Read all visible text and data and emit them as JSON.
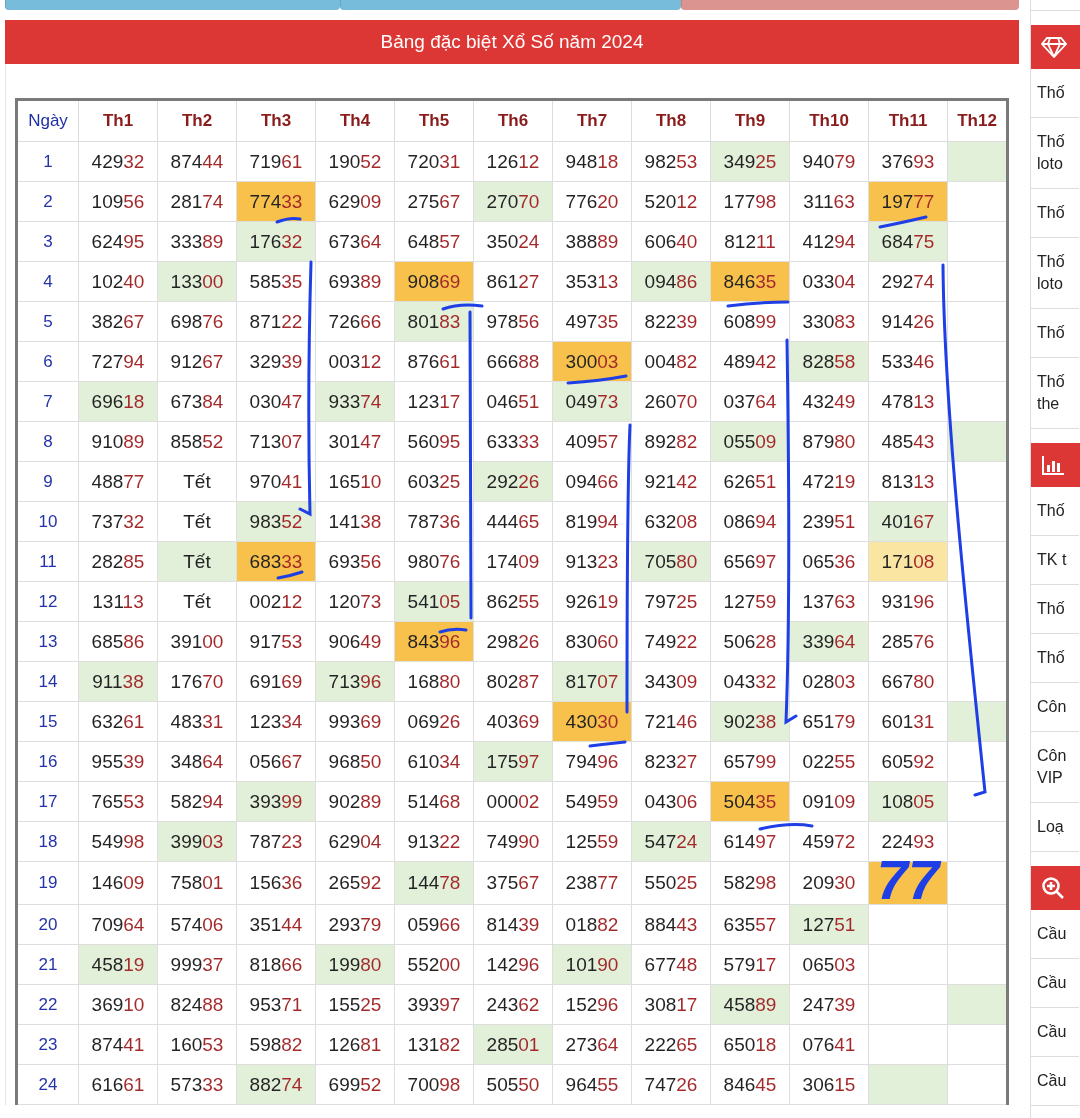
{
  "title_bar": "Bảng đặc biệt Xổ Số năm 2024",
  "table": {
    "columns": [
      "Ngày",
      "Th1",
      "Th2",
      "Th3",
      "Th4",
      "Th5",
      "Th6",
      "Th7",
      "Th8",
      "Th9",
      "Th10",
      "Th11",
      "Th12"
    ],
    "rows": [
      {
        "cells": [
          {
            "kind": "day",
            "value": "1"
          },
          {
            "kind": "number",
            "value": "42932",
            "color": "#ffffff"
          },
          {
            "kind": "number",
            "value": "87444",
            "color": "#ffffff"
          },
          {
            "kind": "number",
            "value": "71961",
            "color": "#ffffff"
          },
          {
            "kind": "number",
            "value": "19052",
            "color": "#ffffff"
          },
          {
            "kind": "number",
            "value": "72031",
            "color": "#ffffff"
          },
          {
            "kind": "number",
            "value": "12612",
            "color": "#ffffff"
          },
          {
            "kind": "number",
            "value": "94818",
            "color": "#ffffff"
          },
          {
            "kind": "number",
            "value": "98253",
            "color": "#ffffff"
          },
          {
            "kind": "number",
            "value": "34925",
            "color": "#e2efd9"
          },
          {
            "kind": "number",
            "value": "94079",
            "color": "#ffffff"
          },
          {
            "kind": "number",
            "value": "37693",
            "color": "#ffffff"
          },
          {
            "kind": "empty",
            "color": "#e2efd9"
          }
        ]
      },
      {
        "cells": [
          {
            "kind": "day",
            "value": "2"
          },
          {
            "kind": "number",
            "value": "10956",
            "color": "#ffffff"
          },
          {
            "kind": "number",
            "value": "28174",
            "color": "#ffffff"
          },
          {
            "kind": "number",
            "value": "77433",
            "color": "#f7c14c"
          },
          {
            "kind": "number",
            "value": "62909",
            "color": "#ffffff"
          },
          {
            "kind": "number",
            "value": "27567",
            "color": "#ffffff"
          },
          {
            "kind": "number",
            "value": "27070",
            "color": "#e2efd9"
          },
          {
            "kind": "number",
            "value": "77620",
            "color": "#ffffff"
          },
          {
            "kind": "number",
            "value": "52012",
            "color": "#ffffff"
          },
          {
            "kind": "number",
            "value": "17798",
            "color": "#ffffff"
          },
          {
            "kind": "number",
            "value": "31163",
            "color": "#ffffff"
          },
          {
            "kind": "number",
            "value": "19777",
            "color": "#f7c14c"
          },
          {
            "kind": "empty",
            "color": "#ffffff"
          }
        ]
      },
      {
        "cells": [
          {
            "kind": "day",
            "value": "3"
          },
          {
            "kind": "number",
            "value": "62495",
            "color": "#ffffff"
          },
          {
            "kind": "number",
            "value": "33389",
            "color": "#ffffff"
          },
          {
            "kind": "number",
            "value": "17632",
            "color": "#e2efd9"
          },
          {
            "kind": "number",
            "value": "67364",
            "color": "#ffffff"
          },
          {
            "kind": "number",
            "value": "64857",
            "color": "#ffffff"
          },
          {
            "kind": "number",
            "value": "35024",
            "color": "#ffffff"
          },
          {
            "kind": "number",
            "value": "38889",
            "color": "#ffffff"
          },
          {
            "kind": "number",
            "value": "60640",
            "color": "#ffffff"
          },
          {
            "kind": "number",
            "value": "81211",
            "color": "#ffffff"
          },
          {
            "kind": "number",
            "value": "41294",
            "color": "#ffffff"
          },
          {
            "kind": "number",
            "value": "68475",
            "color": "#e2efd9"
          },
          {
            "kind": "empty",
            "color": "#ffffff"
          }
        ]
      },
      {
        "cells": [
          {
            "kind": "day",
            "value": "4"
          },
          {
            "kind": "number",
            "value": "10240",
            "color": "#ffffff"
          },
          {
            "kind": "number",
            "value": "13300",
            "color": "#e2efd9"
          },
          {
            "kind": "number",
            "value": "58535",
            "color": "#ffffff"
          },
          {
            "kind": "number",
            "value": "69389",
            "color": "#ffffff"
          },
          {
            "kind": "number",
            "value": "90869",
            "color": "#f7c14c"
          },
          {
            "kind": "number",
            "value": "86127",
            "color": "#ffffff"
          },
          {
            "kind": "number",
            "value": "35313",
            "color": "#ffffff"
          },
          {
            "kind": "number",
            "value": "09486",
            "color": "#e2efd9"
          },
          {
            "kind": "number",
            "value": "84635",
            "color": "#f7c14c"
          },
          {
            "kind": "number",
            "value": "03304",
            "color": "#ffffff"
          },
          {
            "kind": "number",
            "value": "29274",
            "color": "#ffffff"
          },
          {
            "kind": "empty",
            "color": "#ffffff"
          }
        ]
      },
      {
        "cells": [
          {
            "kind": "day",
            "value": "5"
          },
          {
            "kind": "number",
            "value": "38267",
            "color": "#ffffff"
          },
          {
            "kind": "number",
            "value": "69876",
            "color": "#ffffff"
          },
          {
            "kind": "number",
            "value": "87122",
            "color": "#ffffff"
          },
          {
            "kind": "number",
            "value": "72666",
            "color": "#ffffff"
          },
          {
            "kind": "number",
            "value": "80183",
            "color": "#e2efd9"
          },
          {
            "kind": "number",
            "value": "97856",
            "color": "#ffffff"
          },
          {
            "kind": "number",
            "value": "49735",
            "color": "#ffffff"
          },
          {
            "kind": "number",
            "value": "82239",
            "color": "#ffffff"
          },
          {
            "kind": "number",
            "value": "60899",
            "color": "#ffffff"
          },
          {
            "kind": "number",
            "value": "33083",
            "color": "#ffffff"
          },
          {
            "kind": "number",
            "value": "91426",
            "color": "#ffffff"
          },
          {
            "kind": "empty",
            "color": "#ffffff"
          }
        ]
      },
      {
        "cells": [
          {
            "kind": "day",
            "value": "6"
          },
          {
            "kind": "number",
            "value": "72794",
            "color": "#ffffff"
          },
          {
            "kind": "number",
            "value": "91267",
            "color": "#ffffff"
          },
          {
            "kind": "number",
            "value": "32939",
            "color": "#ffffff"
          },
          {
            "kind": "number",
            "value": "00312",
            "color": "#ffffff"
          },
          {
            "kind": "number",
            "value": "87661",
            "color": "#ffffff"
          },
          {
            "kind": "number",
            "value": "66688",
            "color": "#ffffff"
          },
          {
            "kind": "number",
            "value": "30003",
            "color": "#f7c14c"
          },
          {
            "kind": "number",
            "value": "00482",
            "color": "#ffffff"
          },
          {
            "kind": "number",
            "value": "48942",
            "color": "#ffffff"
          },
          {
            "kind": "number",
            "value": "82858",
            "color": "#e2efd9"
          },
          {
            "kind": "number",
            "value": "53346",
            "color": "#ffffff"
          },
          {
            "kind": "empty",
            "color": "#ffffff"
          }
        ]
      },
      {
        "cells": [
          {
            "kind": "day",
            "value": "7"
          },
          {
            "kind": "number",
            "value": "69618",
            "color": "#e2efd9"
          },
          {
            "kind": "number",
            "value": "67384",
            "color": "#ffffff"
          },
          {
            "kind": "number",
            "value": "03047",
            "color": "#ffffff"
          },
          {
            "kind": "number",
            "value": "93374",
            "color": "#e2efd9"
          },
          {
            "kind": "number",
            "value": "12317",
            "color": "#ffffff"
          },
          {
            "kind": "number",
            "value": "04651",
            "color": "#ffffff"
          },
          {
            "kind": "number",
            "value": "04973",
            "color": "#e2efd9"
          },
          {
            "kind": "number",
            "value": "26070",
            "color": "#ffffff"
          },
          {
            "kind": "number",
            "value": "03764",
            "color": "#ffffff"
          },
          {
            "kind": "number",
            "value": "43249",
            "color": "#ffffff"
          },
          {
            "kind": "number",
            "value": "47813",
            "color": "#ffffff"
          },
          {
            "kind": "empty",
            "color": "#ffffff"
          }
        ]
      },
      {
        "cells": [
          {
            "kind": "day",
            "value": "8"
          },
          {
            "kind": "number",
            "value": "91089",
            "color": "#ffffff"
          },
          {
            "kind": "number",
            "value": "85852",
            "color": "#ffffff"
          },
          {
            "kind": "number",
            "value": "71307",
            "color": "#ffffff"
          },
          {
            "kind": "number",
            "value": "30147",
            "color": "#ffffff"
          },
          {
            "kind": "number",
            "value": "56095",
            "color": "#ffffff"
          },
          {
            "kind": "number",
            "value": "63333",
            "color": "#ffffff"
          },
          {
            "kind": "number",
            "value": "40957",
            "color": "#ffffff"
          },
          {
            "kind": "number",
            "value": "89282",
            "color": "#ffffff"
          },
          {
            "kind": "number",
            "value": "05509",
            "color": "#e2efd9"
          },
          {
            "kind": "number",
            "value": "87980",
            "color": "#ffffff"
          },
          {
            "kind": "number",
            "value": "48543",
            "color": "#ffffff"
          },
          {
            "kind": "empty",
            "color": "#e2efd9"
          }
        ]
      },
      {
        "cells": [
          {
            "kind": "day",
            "value": "9"
          },
          {
            "kind": "number",
            "value": "48877",
            "color": "#ffffff"
          },
          {
            "kind": "word",
            "value": "Tết",
            "color": "#ffffff"
          },
          {
            "kind": "number",
            "value": "97041",
            "color": "#ffffff"
          },
          {
            "kind": "number",
            "value": "16510",
            "color": "#ffffff"
          },
          {
            "kind": "number",
            "value": "60325",
            "color": "#ffffff"
          },
          {
            "kind": "number",
            "value": "29226",
            "color": "#e2efd9"
          },
          {
            "kind": "number",
            "value": "09466",
            "color": "#ffffff"
          },
          {
            "kind": "number",
            "value": "92142",
            "color": "#ffffff"
          },
          {
            "kind": "number",
            "value": "62651",
            "color": "#ffffff"
          },
          {
            "kind": "number",
            "value": "47219",
            "color": "#ffffff"
          },
          {
            "kind": "number",
            "value": "81313",
            "color": "#ffffff"
          },
          {
            "kind": "empty",
            "color": "#ffffff"
          }
        ]
      },
      {
        "cells": [
          {
            "kind": "day",
            "value": "10"
          },
          {
            "kind": "number",
            "value": "73732",
            "color": "#ffffff"
          },
          {
            "kind": "word",
            "value": "Tết",
            "color": "#ffffff"
          },
          {
            "kind": "number",
            "value": "98352",
            "color": "#e2efd9"
          },
          {
            "kind": "number",
            "value": "14138",
            "color": "#ffffff"
          },
          {
            "kind": "number",
            "value": "78736",
            "color": "#ffffff"
          },
          {
            "kind": "number",
            "value": "44465",
            "color": "#ffffff"
          },
          {
            "kind": "number",
            "value": "81994",
            "color": "#ffffff"
          },
          {
            "kind": "number",
            "value": "63208",
            "color": "#ffffff"
          },
          {
            "kind": "number",
            "value": "08694",
            "color": "#ffffff"
          },
          {
            "kind": "number",
            "value": "23951",
            "color": "#ffffff"
          },
          {
            "kind": "number",
            "value": "40167",
            "color": "#e2efd9"
          },
          {
            "kind": "empty",
            "color": "#ffffff"
          }
        ]
      },
      {
        "cells": [
          {
            "kind": "day",
            "value": "11"
          },
          {
            "kind": "number",
            "value": "28285",
            "color": "#ffffff"
          },
          {
            "kind": "word",
            "value": "Tết",
            "color": "#e2efd9"
          },
          {
            "kind": "number",
            "value": "68333",
            "color": "#f7c14c"
          },
          {
            "kind": "number",
            "value": "69356",
            "color": "#ffffff"
          },
          {
            "kind": "number",
            "value": "98076",
            "color": "#ffffff"
          },
          {
            "kind": "number",
            "value": "17409",
            "color": "#ffffff"
          },
          {
            "kind": "number",
            "value": "91323",
            "color": "#ffffff"
          },
          {
            "kind": "number",
            "value": "70580",
            "color": "#e2efd9"
          },
          {
            "kind": "number",
            "value": "65697",
            "color": "#ffffff"
          },
          {
            "kind": "number",
            "value": "06536",
            "color": "#ffffff"
          },
          {
            "kind": "number",
            "value": "17108",
            "color": "#fbe5a3"
          },
          {
            "kind": "empty",
            "color": "#ffffff"
          }
        ]
      },
      {
        "cells": [
          {
            "kind": "day",
            "value": "12"
          },
          {
            "kind": "number",
            "value": "13113",
            "color": "#ffffff"
          },
          {
            "kind": "word",
            "value": "Tết",
            "color": "#ffffff"
          },
          {
            "kind": "number",
            "value": "00212",
            "color": "#ffffff"
          },
          {
            "kind": "number",
            "value": "12073",
            "color": "#ffffff"
          },
          {
            "kind": "number",
            "value": "54105",
            "color": "#e2efd9"
          },
          {
            "kind": "number",
            "value": "86255",
            "color": "#ffffff"
          },
          {
            "kind": "number",
            "value": "92619",
            "color": "#ffffff"
          },
          {
            "kind": "number",
            "value": "79725",
            "color": "#ffffff"
          },
          {
            "kind": "number",
            "value": "12759",
            "color": "#ffffff"
          },
          {
            "kind": "number",
            "value": "13763",
            "color": "#ffffff"
          },
          {
            "kind": "number",
            "value": "93196",
            "color": "#ffffff"
          },
          {
            "kind": "empty",
            "color": "#ffffff"
          }
        ]
      },
      {
        "cells": [
          {
            "kind": "day",
            "value": "13"
          },
          {
            "kind": "number",
            "value": "68586",
            "color": "#ffffff"
          },
          {
            "kind": "number",
            "value": "39100",
            "color": "#ffffff"
          },
          {
            "kind": "number",
            "value": "91753",
            "color": "#ffffff"
          },
          {
            "kind": "number",
            "value": "90649",
            "color": "#ffffff"
          },
          {
            "kind": "number",
            "value": "84396",
            "color": "#f7c14c"
          },
          {
            "kind": "number",
            "value": "29826",
            "color": "#ffffff"
          },
          {
            "kind": "number",
            "value": "83060",
            "color": "#ffffff"
          },
          {
            "kind": "number",
            "value": "74922",
            "color": "#ffffff"
          },
          {
            "kind": "number",
            "value": "50628",
            "color": "#ffffff"
          },
          {
            "kind": "number",
            "value": "33964",
            "color": "#e2efd9"
          },
          {
            "kind": "number",
            "value": "28576",
            "color": "#ffffff"
          },
          {
            "kind": "empty",
            "color": "#ffffff"
          }
        ]
      },
      {
        "cells": [
          {
            "kind": "day",
            "value": "14"
          },
          {
            "kind": "number",
            "value": "91138",
            "color": "#e2efd9"
          },
          {
            "kind": "number",
            "value": "17670",
            "color": "#ffffff"
          },
          {
            "kind": "number",
            "value": "69169",
            "color": "#ffffff"
          },
          {
            "kind": "number",
            "value": "71396",
            "color": "#e2efd9"
          },
          {
            "kind": "number",
            "value": "16880",
            "color": "#ffffff"
          },
          {
            "kind": "number",
            "value": "80287",
            "color": "#ffffff"
          },
          {
            "kind": "number",
            "value": "81707",
            "color": "#e2efd9"
          },
          {
            "kind": "number",
            "value": "34309",
            "color": "#ffffff"
          },
          {
            "kind": "number",
            "value": "04332",
            "color": "#ffffff"
          },
          {
            "kind": "number",
            "value": "02803",
            "color": "#ffffff"
          },
          {
            "kind": "number",
            "value": "66780",
            "color": "#ffffff"
          },
          {
            "kind": "empty",
            "color": "#ffffff"
          }
        ]
      },
      {
        "cells": [
          {
            "kind": "day",
            "value": "15"
          },
          {
            "kind": "number",
            "value": "63261",
            "color": "#ffffff"
          },
          {
            "kind": "number",
            "value": "48331",
            "color": "#ffffff"
          },
          {
            "kind": "number",
            "value": "12334",
            "color": "#ffffff"
          },
          {
            "kind": "number",
            "value": "99369",
            "color": "#ffffff"
          },
          {
            "kind": "number",
            "value": "06926",
            "color": "#ffffff"
          },
          {
            "kind": "number",
            "value": "40369",
            "color": "#ffffff"
          },
          {
            "kind": "number",
            "value": "43030",
            "color": "#f7c14c"
          },
          {
            "kind": "number",
            "value": "72146",
            "color": "#ffffff"
          },
          {
            "kind": "number",
            "value": "90238",
            "color": "#e2efd9"
          },
          {
            "kind": "number",
            "value": "65179",
            "color": "#ffffff"
          },
          {
            "kind": "number",
            "value": "60131",
            "color": "#ffffff"
          },
          {
            "kind": "empty",
            "color": "#e2efd9"
          }
        ]
      },
      {
        "cells": [
          {
            "kind": "day",
            "value": "16"
          },
          {
            "kind": "number",
            "value": "95539",
            "color": "#ffffff"
          },
          {
            "kind": "number",
            "value": "34864",
            "color": "#ffffff"
          },
          {
            "kind": "number",
            "value": "05667",
            "color": "#ffffff"
          },
          {
            "kind": "number",
            "value": "96850",
            "color": "#ffffff"
          },
          {
            "kind": "number",
            "value": "61034",
            "color": "#ffffff"
          },
          {
            "kind": "number",
            "value": "17597",
            "color": "#e2efd9"
          },
          {
            "kind": "number",
            "value": "79496",
            "color": "#ffffff"
          },
          {
            "kind": "number",
            "value": "82327",
            "color": "#ffffff"
          },
          {
            "kind": "number",
            "value": "65799",
            "color": "#ffffff"
          },
          {
            "kind": "number",
            "value": "02255",
            "color": "#ffffff"
          },
          {
            "kind": "number",
            "value": "60592",
            "color": "#ffffff"
          },
          {
            "kind": "empty",
            "color": "#ffffff"
          }
        ]
      },
      {
        "cells": [
          {
            "kind": "day",
            "value": "17"
          },
          {
            "kind": "number",
            "value": "76553",
            "color": "#ffffff"
          },
          {
            "kind": "number",
            "value": "58294",
            "color": "#ffffff"
          },
          {
            "kind": "number",
            "value": "39399",
            "color": "#e2efd9"
          },
          {
            "kind": "number",
            "value": "90289",
            "color": "#ffffff"
          },
          {
            "kind": "number",
            "value": "51468",
            "color": "#ffffff"
          },
          {
            "kind": "number",
            "value": "00002",
            "color": "#ffffff"
          },
          {
            "kind": "number",
            "value": "54959",
            "color": "#ffffff"
          },
          {
            "kind": "number",
            "value": "04306",
            "color": "#ffffff"
          },
          {
            "kind": "number",
            "value": "50435",
            "color": "#f7c14c"
          },
          {
            "kind": "number",
            "value": "09109",
            "color": "#ffffff"
          },
          {
            "kind": "number",
            "value": "10805",
            "color": "#e2efd9"
          },
          {
            "kind": "empty",
            "color": "#ffffff"
          }
        ]
      },
      {
        "cells": [
          {
            "kind": "day",
            "value": "18"
          },
          {
            "kind": "number",
            "value": "54998",
            "color": "#ffffff"
          },
          {
            "kind": "number",
            "value": "39903",
            "color": "#e2efd9"
          },
          {
            "kind": "number",
            "value": "78723",
            "color": "#ffffff"
          },
          {
            "kind": "number",
            "value": "62904",
            "color": "#ffffff"
          },
          {
            "kind": "number",
            "value": "91322",
            "color": "#ffffff"
          },
          {
            "kind": "number",
            "value": "74990",
            "color": "#ffffff"
          },
          {
            "kind": "number",
            "value": "12559",
            "color": "#ffffff"
          },
          {
            "kind": "number",
            "value": "54724",
            "color": "#e2efd9"
          },
          {
            "kind": "number",
            "value": "61497",
            "color": "#ffffff"
          },
          {
            "kind": "number",
            "value": "45972",
            "color": "#ffffff"
          },
          {
            "kind": "number",
            "value": "22493",
            "color": "#ffffff"
          },
          {
            "kind": "empty",
            "color": "#ffffff"
          }
        ]
      },
      {
        "cells": [
          {
            "kind": "day",
            "value": "19"
          },
          {
            "kind": "number",
            "value": "14609",
            "color": "#ffffff"
          },
          {
            "kind": "number",
            "value": "75801",
            "color": "#ffffff"
          },
          {
            "kind": "number",
            "value": "15636",
            "color": "#ffffff"
          },
          {
            "kind": "number",
            "value": "26592",
            "color": "#ffffff"
          },
          {
            "kind": "number",
            "value": "14478",
            "color": "#e2efd9"
          },
          {
            "kind": "number",
            "value": "37567",
            "color": "#ffffff"
          },
          {
            "kind": "number",
            "value": "23877",
            "color": "#ffffff"
          },
          {
            "kind": "number",
            "value": "55025",
            "color": "#ffffff"
          },
          {
            "kind": "number",
            "value": "58298",
            "color": "#ffffff"
          },
          {
            "kind": "number",
            "value": "20930",
            "color": "#ffffff"
          },
          {
            "kind": "handwritten",
            "value": "77",
            "color": "#f7c14c"
          },
          {
            "kind": "empty",
            "color": "#ffffff"
          }
        ]
      },
      {
        "cells": [
          {
            "kind": "day",
            "value": "20"
          },
          {
            "kind": "number",
            "value": "70964",
            "color": "#ffffff"
          },
          {
            "kind": "number",
            "value": "57406",
            "color": "#ffffff"
          },
          {
            "kind": "number",
            "value": "35144",
            "color": "#ffffff"
          },
          {
            "kind": "number",
            "value": "29379",
            "color": "#ffffff"
          },
          {
            "kind": "number",
            "value": "05966",
            "color": "#ffffff"
          },
          {
            "kind": "number",
            "value": "81439",
            "color": "#ffffff"
          },
          {
            "kind": "number",
            "value": "01882",
            "color": "#ffffff"
          },
          {
            "kind": "number",
            "value": "88443",
            "color": "#ffffff"
          },
          {
            "kind": "number",
            "value": "63557",
            "color": "#ffffff"
          },
          {
            "kind": "number",
            "value": "12751",
            "color": "#e2efd9"
          },
          {
            "kind": "empty",
            "color": "#ffffff"
          },
          {
            "kind": "empty",
            "color": "#ffffff"
          }
        ]
      },
      {
        "cells": [
          {
            "kind": "day",
            "value": "21"
          },
          {
            "kind": "number",
            "value": "45819",
            "color": "#e2efd9"
          },
          {
            "kind": "number",
            "value": "99937",
            "color": "#ffffff"
          },
          {
            "kind": "number",
            "value": "81866",
            "color": "#ffffff"
          },
          {
            "kind": "number",
            "value": "19980",
            "color": "#e2efd9"
          },
          {
            "kind": "number",
            "value": "55200",
            "color": "#ffffff"
          },
          {
            "kind": "number",
            "value": "14296",
            "color": "#ffffff"
          },
          {
            "kind": "number",
            "value": "10190",
            "color": "#e2efd9"
          },
          {
            "kind": "number",
            "value": "67748",
            "color": "#ffffff"
          },
          {
            "kind": "number",
            "value": "57917",
            "color": "#ffffff"
          },
          {
            "kind": "number",
            "value": "06503",
            "color": "#ffffff"
          },
          {
            "kind": "empty",
            "color": "#ffffff"
          },
          {
            "kind": "empty",
            "color": "#ffffff"
          }
        ]
      },
      {
        "cells": [
          {
            "kind": "day",
            "value": "22"
          },
          {
            "kind": "number",
            "value": "36910",
            "color": "#ffffff"
          },
          {
            "kind": "number",
            "value": "82488",
            "color": "#ffffff"
          },
          {
            "kind": "number",
            "value": "95371",
            "color": "#ffffff"
          },
          {
            "kind": "number",
            "value": "15525",
            "color": "#ffffff"
          },
          {
            "kind": "number",
            "value": "39397",
            "color": "#ffffff"
          },
          {
            "kind": "number",
            "value": "24362",
            "color": "#ffffff"
          },
          {
            "kind": "number",
            "value": "15296",
            "color": "#ffffff"
          },
          {
            "kind": "number",
            "value": "30817",
            "color": "#ffffff"
          },
          {
            "kind": "number",
            "value": "45889",
            "color": "#e2efd9"
          },
          {
            "kind": "number",
            "value": "24739",
            "color": "#ffffff"
          },
          {
            "kind": "empty",
            "color": "#ffffff"
          },
          {
            "kind": "empty",
            "color": "#e2efd9"
          }
        ]
      },
      {
        "cells": [
          {
            "kind": "day",
            "value": "23"
          },
          {
            "kind": "number",
            "value": "87441",
            "color": "#ffffff"
          },
          {
            "kind": "number",
            "value": "16053",
            "color": "#ffffff"
          },
          {
            "kind": "number",
            "value": "59882",
            "color": "#ffffff"
          },
          {
            "kind": "number",
            "value": "12681",
            "color": "#ffffff"
          },
          {
            "kind": "number",
            "value": "13182",
            "color": "#ffffff"
          },
          {
            "kind": "number",
            "value": "28501",
            "color": "#e2efd9"
          },
          {
            "kind": "number",
            "value": "27364",
            "color": "#ffffff"
          },
          {
            "kind": "number",
            "value": "22265",
            "color": "#ffffff"
          },
          {
            "kind": "number",
            "value": "65018",
            "color": "#ffffff"
          },
          {
            "kind": "number",
            "value": "07641",
            "color": "#ffffff"
          },
          {
            "kind": "empty",
            "color": "#ffffff"
          },
          {
            "kind": "empty",
            "color": "#ffffff"
          }
        ]
      },
      {
        "cells": [
          {
            "kind": "day",
            "value": "24"
          },
          {
            "kind": "number",
            "value": "61661",
            "color": "#ffffff"
          },
          {
            "kind": "number",
            "value": "57333",
            "color": "#ffffff"
          },
          {
            "kind": "number",
            "value": "88274",
            "color": "#e2efd9"
          },
          {
            "kind": "number",
            "value": "69952",
            "color": "#ffffff"
          },
          {
            "kind": "number",
            "value": "70098",
            "color": "#ffffff"
          },
          {
            "kind": "number",
            "value": "50550",
            "color": "#ffffff"
          },
          {
            "kind": "number",
            "value": "96455",
            "color": "#ffffff"
          },
          {
            "kind": "number",
            "value": "74726",
            "color": "#ffffff"
          },
          {
            "kind": "number",
            "value": "84645",
            "color": "#ffffff"
          },
          {
            "kind": "number",
            "value": "30615",
            "color": "#ffffff"
          },
          {
            "kind": "empty",
            "color": "#e2efd9"
          },
          {
            "kind": "empty",
            "color": "#ffffff"
          }
        ]
      }
    ]
  },
  "sidebar": {
    "groups": [
      {
        "items": [
          "Thố",
          "Thố loto",
          "Thố",
          "Thố loto",
          "Thố",
          "Thố the"
        ]
      },
      {
        "items": [
          "Thố",
          "TK t",
          "Thố",
          "Thố",
          "Côn",
          "Côn VIP",
          "Loạ"
        ]
      },
      {
        "items": [
          "Cầu",
          "Cầu",
          "Cầu",
          "Cầu"
        ]
      }
    ]
  }
}
